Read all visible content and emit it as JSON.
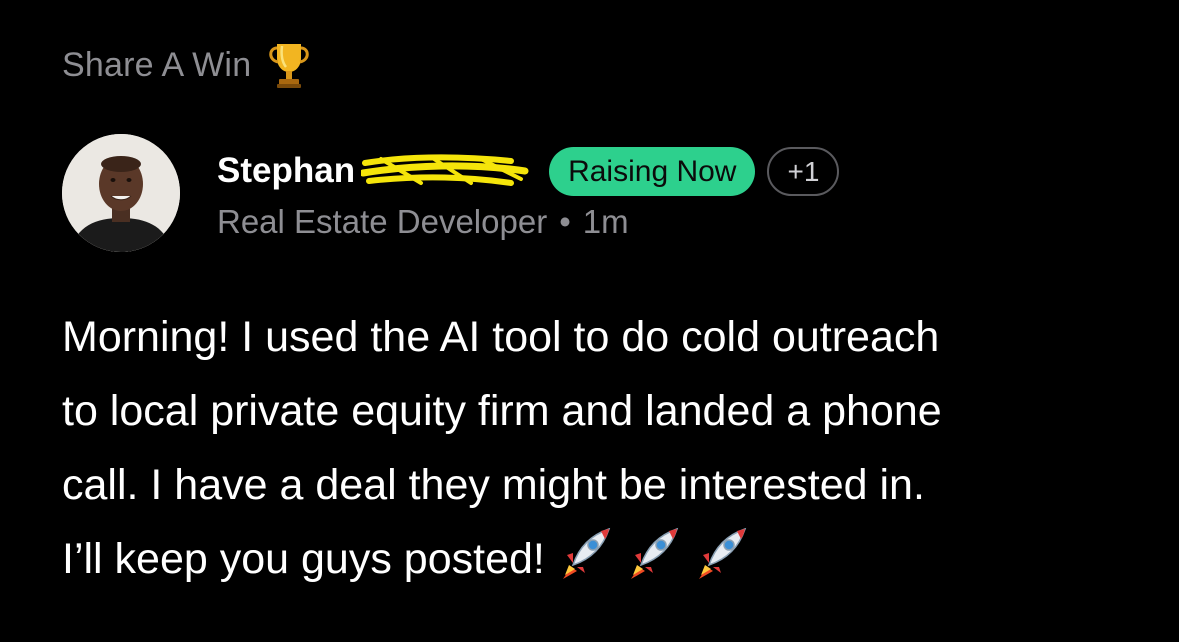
{
  "header": {
    "category_label": "Share A Win",
    "category_icon": "trophy-icon"
  },
  "author": {
    "first_name": "Stephan",
    "last_name_redacted": true,
    "redaction_color": "#f5e50a",
    "title": "Real Estate Developer",
    "separator": "•",
    "time_ago": "1m"
  },
  "badges": {
    "status": "Raising Now",
    "status_color": "#2dd08d",
    "extra_count": "+1"
  },
  "post": {
    "text": "Morning! I used the AI tool to do cold outreach\nto local private equity firm and landed a phone\ncall. I have a deal they might be interested in.\nI’ll keep you guys posted!",
    "emoji_icons": [
      "rocket-icon",
      "rocket-icon",
      "rocket-icon"
    ]
  },
  "colors": {
    "background": "#000000",
    "muted_text": "#8e8e93",
    "primary_text": "#ffffff"
  }
}
